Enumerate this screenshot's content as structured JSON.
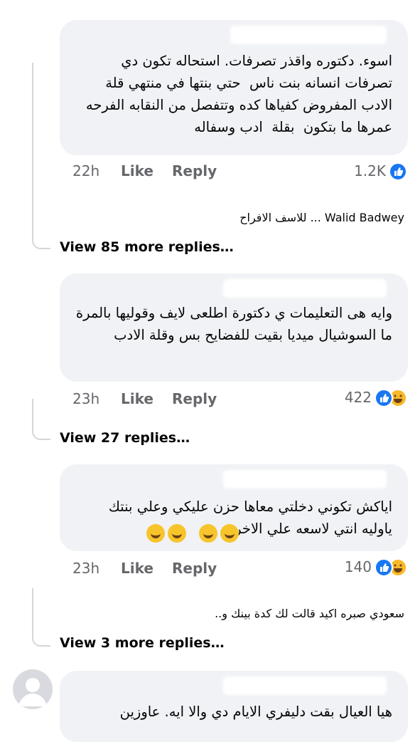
{
  "comments": [
    {
      "text": "اسوء. دكتوره واقذر تصرفات. استحاله تكون دي تصرفات انسانه بنت ناس  حتي بنتها في منتهي قلة الادب المفروض كفياها كده وتتفصل من النقابه الفرحه عمرها ما بتكون  بقلة  ادب وسفاله",
      "time": "22h",
      "like_label": "Like",
      "reply_label": "Reply",
      "reaction_count": "1.2K",
      "reply_preview": "Walid Badwey ... للاسف الافراح",
      "view_replies": "View 85 more replies…"
    },
    {
      "text": "وايه هى التعليمات ي دكتورة اطلعى لايف وقوليها بالمرة ما السوشيال ميديا بقيت للفضايح بس وقلة الادب",
      "time": "23h",
      "like_label": "Like",
      "reply_label": "Reply",
      "reaction_count": "422",
      "view_replies": "View 27 replies…"
    },
    {
      "text": "اياكش تكوني دخلتي معاها حزن عليكي وعلي بنتك\nياوليه انتي لاسعه علي الاخر",
      "time": "23h",
      "like_label": "Like",
      "reply_label": "Reply",
      "reaction_count": "140",
      "reply_preview": "سعودي صبره اكيد قالت لك كدة بينك و..",
      "view_replies": "View 3 more replies…"
    },
    {
      "text": "هيا العيال بقت دليفري الايام دي والا ايه. عاوزين"
    }
  ],
  "icons": {
    "like": "like-reaction-icon",
    "haha": "haha-reaction-icon",
    "avatar": "default-avatar-icon",
    "emoji": "rolling-laughing-emoji"
  },
  "colors": {
    "bubble": "#f0f2f5",
    "meta": "#65676b",
    "like_blue": "#1877f2",
    "thread_line": "#d4d6da"
  }
}
